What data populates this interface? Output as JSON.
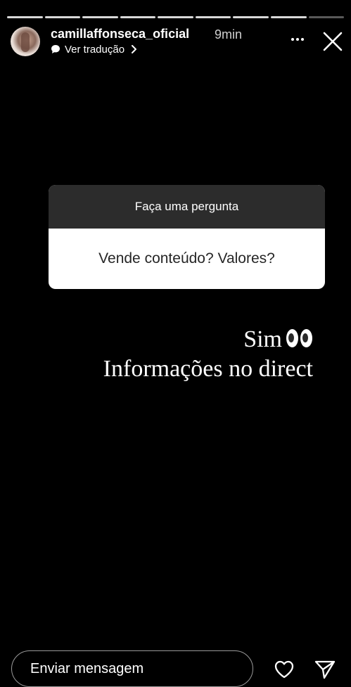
{
  "story": {
    "segments": 9,
    "current_segment": 9,
    "username": "camillaffonseca_oficial",
    "time": "9min",
    "translate_label": "Ver tradução"
  },
  "question_box": {
    "header": "Faça uma pergunta",
    "question": "Vende conteúdo? Valores?"
  },
  "answer": {
    "line1": "Sim",
    "line2": "Informações no direct",
    "emoji": "eyes-emoji"
  },
  "footer": {
    "message_placeholder": "Enviar mensagem"
  },
  "icons": {
    "more": "more-icon",
    "close": "close-icon",
    "like": "heart-icon",
    "send": "send-icon",
    "translate": "translate-bubble-icon"
  }
}
